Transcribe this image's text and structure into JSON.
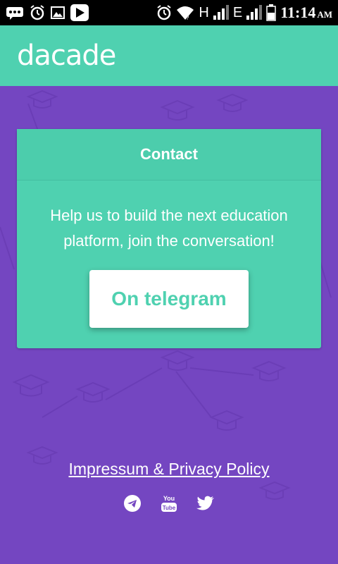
{
  "status_bar": {
    "net_h": "H",
    "net_e": "E",
    "time": "11:14",
    "ampm": "AM",
    "icons": [
      "message-icon",
      "alarm-icon",
      "image-icon",
      "play-store-icon",
      "alarm-icon",
      "wifi-icon",
      "signal-icon",
      "signal-icon",
      "battery-icon"
    ]
  },
  "header": {
    "logo": "dacade"
  },
  "card": {
    "title": "Contact",
    "text": "Help us to build the next education platform, join the conversation!",
    "button_label": "On telegram"
  },
  "footer": {
    "link_label": "Impressum & Privacy Policy",
    "social_icons": [
      "telegram-icon",
      "youtube-icon",
      "twitter-icon"
    ]
  },
  "colors": {
    "primary_teal": "#4fd1b0",
    "purple_background": "#7446c1",
    "white": "#ffffff"
  }
}
